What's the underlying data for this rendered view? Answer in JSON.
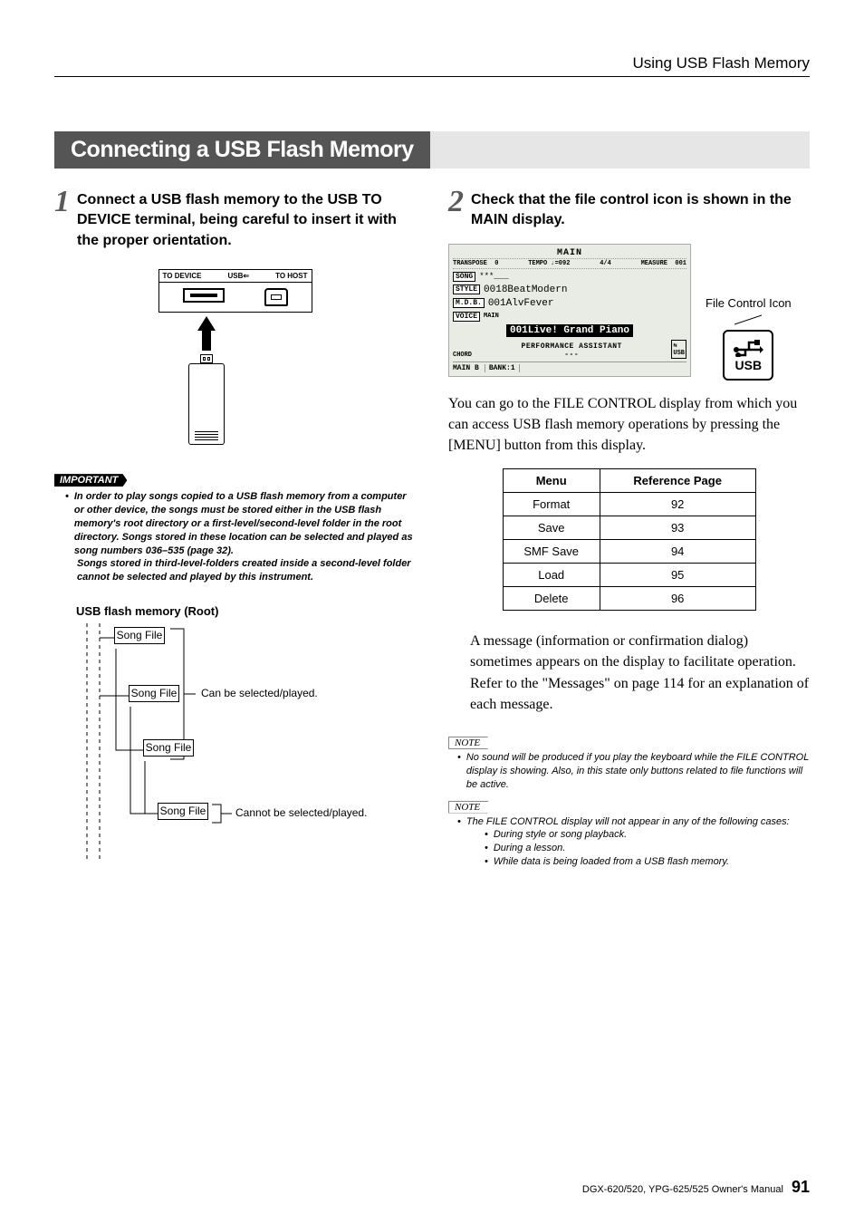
{
  "header": {
    "title": "Using USB Flash Memory"
  },
  "section": {
    "title": "Connecting a USB Flash Memory"
  },
  "step1": {
    "num": "1",
    "text": "Connect a USB flash memory to the USB TO DEVICE terminal, being careful to insert it with the proper orientation."
  },
  "usb": {
    "to_device": "TO DEVICE",
    "usb": "USB",
    "to_host": "TO HOST"
  },
  "important": {
    "label": "IMPORTANT",
    "text": "In order to play songs copied to a USB flash memory from a computer or other device, the songs must be stored either in the USB flash memory's root directory or a first-level/second-level folder in the root directory. Songs stored in these location can be selected and played as song numbers 036–535 (page 32).",
    "text2": "Songs stored in third-level-folders created inside a second-level folder cannot be selected and played by this instrument."
  },
  "tree": {
    "title": "USB flash memory (Root)",
    "node": "Song File",
    "can": "Can be selected/played.",
    "cannot": "Cannot be selected/played."
  },
  "step2": {
    "num": "2",
    "text": "Check that the file control icon is shown in the MAIN display."
  },
  "lcd": {
    "main": "MAIN",
    "transpose": "TRANSPOSE",
    "transpose_v": "0",
    "tempo": "TEMPO",
    "tempo_v": "♩=092",
    "sig": "4/4",
    "measure": "MEASURE",
    "measure_v": "001",
    "song": "SONG",
    "song_v": "***___",
    "style": "STYLE",
    "style_v": "0018BeatModern",
    "mdb": "M.D.B.",
    "mdb_v": "001AlvFever",
    "voice_tag": "VOICE",
    "voice_sub": "MAIN",
    "voice_v": "001Live! Grand Piano",
    "chord": "CHORD",
    "assistant": "PERFORMANCE ASSISTANT",
    "assistant_v": "---",
    "main_b": "MAIN B",
    "bank": "BANK:1"
  },
  "callout": {
    "label": "File Control Icon",
    "usb": "USB"
  },
  "para1": "You can go to the FILE CONTROL display from which you can access USB flash memory operations by pressing the [MENU] button from this display.",
  "table": {
    "headers": [
      "Menu",
      "Reference Page"
    ],
    "rows": [
      [
        "Format",
        "92"
      ],
      [
        "Save",
        "93"
      ],
      [
        "SMF Save",
        "94"
      ],
      [
        "Load",
        "95"
      ],
      [
        "Delete",
        "96"
      ]
    ]
  },
  "para2": "A message (information or confirmation dialog) sometimes appears on the display to facilitate operation. Refer to the \"Messages\" on page 114 for an explanation of each message.",
  "note1": {
    "label": "NOTE",
    "text": "No sound will be produced if you play the keyboard while the FILE CONTROL display is showing. Also, in this state only buttons related to file functions will be active."
  },
  "note2": {
    "label": "NOTE",
    "text": "The FILE CONTROL display will not appear in any of the following cases:",
    "items": [
      "During style or song playback.",
      "During a lesson.",
      "While data is being loaded from a USB flash memory."
    ]
  },
  "footer": {
    "manual": "DGX-620/520, YPG-625/525  Owner's Manual",
    "page": "91"
  }
}
